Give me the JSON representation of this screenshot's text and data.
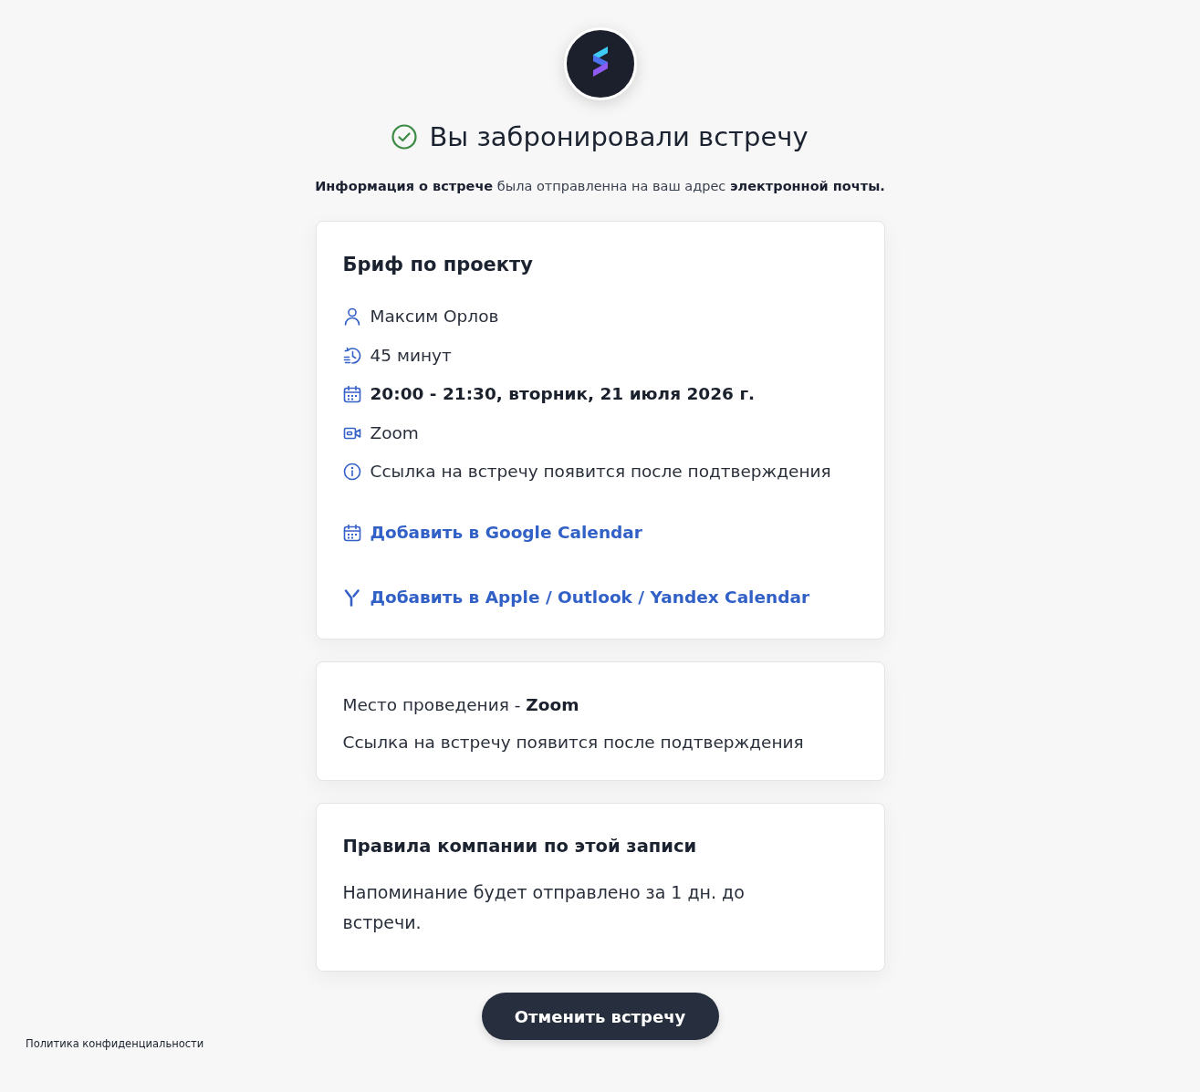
{
  "confirmation": {
    "title": "Вы забронировали встречу",
    "message": "**Информация о встрече** была отправленна на ваш адрес **электронной почты.**"
  },
  "event_card": {
    "title": "Бриф по проекту",
    "details": [
      {
        "kind": "person",
        "text": "Максим Орлов"
      },
      {
        "kind": "duration",
        "text": "45 минут"
      },
      {
        "kind": "datetime",
        "text": "20:00 - 21:30, вторник, 21 июля 2026 г."
      },
      {
        "kind": "video",
        "text": "Zoom"
      },
      {
        "kind": "info",
        "text": "Ссылка на встречу появится после подтверждения"
      }
    ],
    "calendar_links": [
      {
        "kind": "google",
        "label": "Добавить в Google Calendar"
      },
      {
        "kind": "other",
        "label": "Добавить в Apple / Outlook / Yandex Calendar"
      }
    ]
  },
  "location_card": {
    "label": "Место проведения - **Zoom**",
    "note": "Ссылка на встречу появится после подтверждения"
  },
  "policy_card": {
    "title": "Правила компании по этой записи",
    "text": "Напоминание будет отправлено за 1 дн. до встречи."
  },
  "cancel_button": "Отменить встречу",
  "footer": {
    "privacy_link": "Политика конфиденциальности"
  }
}
